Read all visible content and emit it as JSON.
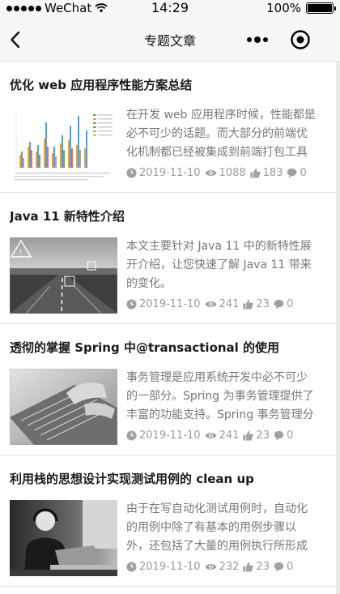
{
  "status_bar": {
    "carrier": "WeChat",
    "time": "14:29",
    "battery_text": "100%",
    "battery_level": 1.0
  },
  "nav": {
    "title": "专题文章"
  },
  "colors": {
    "meta_gray": "#9a9a9a",
    "summary_gray": "#777777"
  },
  "articles": [
    {
      "title": "优化 web 应用程序性能方案总结",
      "summary": "在开发 web 应用程序时候，性能都是必不可少的话题。而大部分的前端优化机制都已经被集成到前端打包工具",
      "date": "2019-11-10",
      "views": "1088",
      "likes": "183",
      "comments": "0",
      "thumb": "bar-chart-thumbnail"
    },
    {
      "title": "Java 11 新特性介绍",
      "summary": "本文主要针对 Java 11 中的新特性展开介绍，让您快速了解 Java 11 带来的变化。",
      "date": "2019-11-10",
      "views": "241",
      "likes": "23",
      "comments": "0",
      "thumb": "road-hud-thumbnail"
    },
    {
      "title": "透彻的掌握 Spring 中@transactional 的使用",
      "summary": "事务管理是应用系统开发中必不可少的一部分。Spring 为事务管理提供了丰富的功能支持。Spring 事务管理分",
      "date": "2019-11-10",
      "views": "241",
      "likes": "23",
      "comments": "0",
      "thumb": "keyboard-hands-thumbnail"
    },
    {
      "title": "利用栈的思想设计实现测试用例的 clean up",
      "summary": "由于在写自动化测试用例时，自动化的用例中除了有基本的用例步骤以外，还包括了大量的用例执行所形成",
      "date": "2019-11-10",
      "views": "232",
      "likes": "23",
      "comments": "0",
      "thumb": "person-laptop-thumbnail"
    }
  ]
}
